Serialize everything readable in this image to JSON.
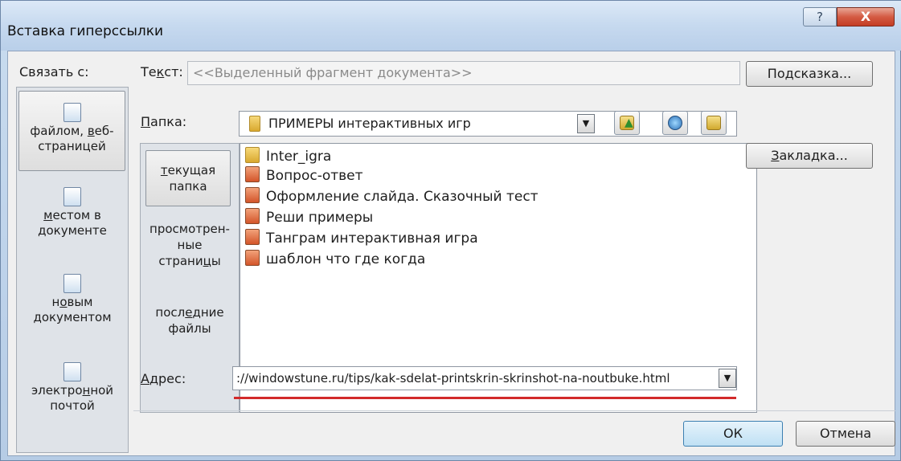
{
  "window": {
    "title": "Вставка гиперссылки",
    "help_label": "?",
    "close_label": "X"
  },
  "link_to": {
    "label": "Связать с:",
    "items": [
      {
        "label_parts": [
          "файлом, ",
          "в",
          "еб-",
          "страницей"
        ],
        "icon": "web-page-icon"
      },
      {
        "label_parts": [
          "м",
          "естом в",
          "документе"
        ],
        "icon": "place-in-document-icon"
      },
      {
        "label_parts": [
          "н",
          "о",
          "вым",
          "документом"
        ],
        "icon": "new-document-icon"
      },
      {
        "label_parts": [
          "электро",
          "н",
          "ной",
          "почтой"
        ],
        "icon": "email-icon"
      }
    ]
  },
  "text_field": {
    "label_pre": "Те",
    "label_u": "к",
    "label_post": "ст:",
    "value": "<<Выделенный фрагмент документа>>"
  },
  "buttons": {
    "tooltip": {
      "pre": "По",
      "u": "д",
      "post": "сказка..."
    },
    "bookmark": {
      "u": "З",
      "post": "акладка..."
    },
    "ok": "ОК",
    "cancel": "Отмена"
  },
  "folder": {
    "label_u": "П",
    "label_post": "апка:",
    "value": "ПРИМЕРЫ интерактивных игр",
    "icons": [
      "up-folder-icon",
      "browse-web-icon",
      "browse-file-icon"
    ]
  },
  "places": [
    {
      "u": "т",
      "lines": [
        "екущая",
        "папка"
      ],
      "selected": true
    },
    {
      "u": "",
      "lines": [
        "просмотрен-",
        "ные",
        "страни",
        "ц",
        "ы"
      ],
      "selected": false
    },
    {
      "u": "",
      "lines": [
        "посл",
        "е",
        "дние",
        "файлы"
      ],
      "selected": false
    }
  ],
  "files": [
    {
      "name": "Inter_igra",
      "icon": "folder-icon"
    },
    {
      "name": "Вопрос-ответ",
      "icon": "powerpoint-icon"
    },
    {
      "name": "Оформление слайда. Сказочный тест",
      "icon": "powerpoint-icon"
    },
    {
      "name": "Реши примеры",
      "icon": "powerpoint-icon"
    },
    {
      "name": "Танграм интерактивная игра",
      "icon": "powerpoint-icon"
    },
    {
      "name": "шаблон что где когда",
      "icon": "powerpoint-icon"
    }
  ],
  "address": {
    "label_u": "А",
    "label_post": "дрес:",
    "value": "://windowstune.ru/tips/kak-sdelat-printskrin-skrinshot-na-noutbuke.html"
  },
  "colors": {
    "highlight_underline": "#d22a2a",
    "close_button": "#c43d24"
  }
}
